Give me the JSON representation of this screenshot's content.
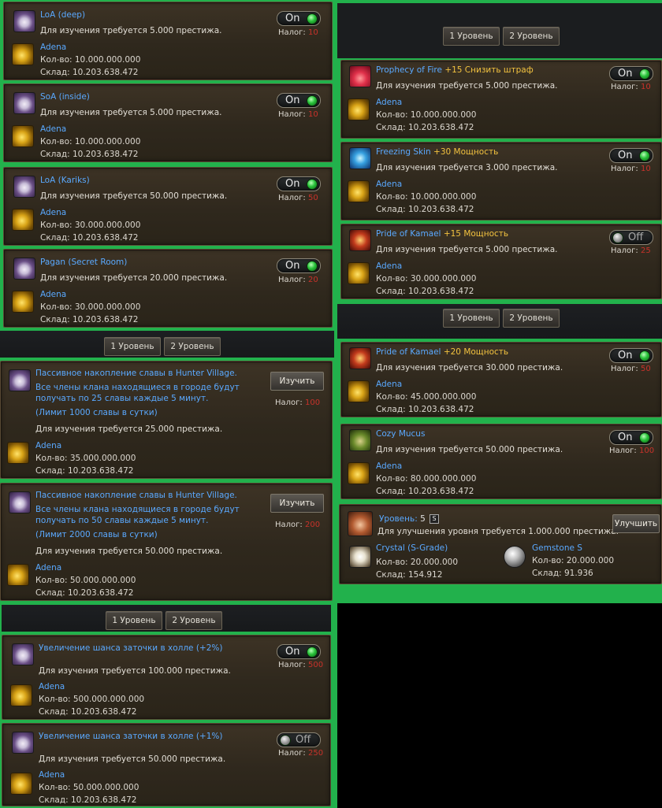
{
  "labels": {
    "requires_prefix": "Для изучения требуется ",
    "requires_suffix": " престижа.",
    "upgrade_requires_prefix": "Для улучшения уровня требуется ",
    "qty_prefix": "Кол-во: ",
    "warehouse_prefix": "Склад: ",
    "tax_label": "Налог: ",
    "adena": "Adena",
    "learn_button": "Изучить",
    "upgrade_button": "Улучшить",
    "level_label": "Уровень:",
    "on": "On",
    "off": "Off",
    "tab1": "1 Уровень",
    "tab2": "2 Уровень"
  },
  "left_skills": [
    {
      "title": "LoA (deep)",
      "prestige": "5.000",
      "qty": "10.000.000.000",
      "warehouse": "10.203.638.472",
      "tax": "10",
      "toggle": "On"
    },
    {
      "title": "SoA (inside)",
      "prestige": "5.000",
      "qty": "10.000.000.000",
      "warehouse": "10.203.638.472",
      "tax": "10",
      "toggle": "On"
    },
    {
      "title": "LoA (Kariks)",
      "prestige": "50.000",
      "qty": "30.000.000.000",
      "warehouse": "10.203.638.472",
      "tax": "50",
      "toggle": "On"
    },
    {
      "title": "Pagan (Secret Room)",
      "prestige": "20.000",
      "qty": "30.000.000.000",
      "warehouse": "10.203.638.472",
      "tax": "20",
      "toggle": "On"
    }
  ],
  "glory_skills": [
    {
      "line1": "Пассивное накопление славы в Hunter Village.",
      "line2": "Все члены клана находящиеся в городе будут",
      "line3": "получать по 25 славы каждые 5 минут.",
      "line4": "(Лимит 1000 славы в сутки)",
      "prestige": "25.000",
      "qty": "35.000.000.000",
      "warehouse": "10.203.638.472",
      "tax": "100"
    },
    {
      "line1": "Пассивное накопление славы в Hunter Village.",
      "line2": "Все члены клана находящиеся в городе будут",
      "line3": "получать по 50 славы каждые 5 минут.",
      "line4": "(Лимит 2000 славы в сутки)",
      "prestige": "50.000",
      "qty": "50.000.000.000",
      "warehouse": "10.203.638.472",
      "tax": "200"
    }
  ],
  "enchant_skills": [
    {
      "title": "Увеличение шанса заточки в холле (+2%)",
      "prestige": "100.000",
      "qty": "500.000.000.000",
      "warehouse": "10.203.638.472",
      "tax": "500",
      "toggle": "On"
    },
    {
      "title": "Увеличение шанса заточки в холле (+1%)",
      "prestige": "50.000",
      "qty": "50.000.000.000",
      "warehouse": "10.203.638.472",
      "tax": "250",
      "toggle": "Off"
    }
  ],
  "right_skills": [
    {
      "title": "Prophecy of Fire",
      "bonus": "+15 Снизить штраф",
      "prestige": "5.000",
      "qty": "10.000.000.000",
      "warehouse": "10.203.638.472",
      "tax": "10",
      "toggle": "On",
      "icon": "fire"
    },
    {
      "title": "Freezing Skin",
      "bonus": "+30 Мощность",
      "prestige": "3.000",
      "qty": "10.000.000.000",
      "warehouse": "10.203.638.472",
      "tax": "10",
      "toggle": "On",
      "icon": "freeze"
    },
    {
      "title": "Pride of Kamael",
      "bonus": "+15 Мощность",
      "prestige": "5.000",
      "qty": "30.000.000.000",
      "warehouse": "10.203.638.472",
      "tax": "25",
      "toggle": "Off",
      "icon": "pride"
    },
    {
      "title": "Pride of Kamael",
      "bonus": "+20 Мощность",
      "prestige": "30.000",
      "qty": "45.000.000.000",
      "warehouse": "10.203.638.472",
      "tax": "50",
      "toggle": "On",
      "icon": "pride"
    },
    {
      "title": "Cozy Mucus",
      "bonus": "",
      "prestige": "50.000",
      "qty": "80.000.000.000",
      "warehouse": "10.203.638.472",
      "tax": "100",
      "toggle": "On",
      "icon": "mucus"
    }
  ],
  "level_panel": {
    "level": "5",
    "grade_badge": "S",
    "prestige": "1.000.000",
    "res1": {
      "name": "Crystal (S-Grade)",
      "qty": "20.000.000",
      "warehouse": "154.912"
    },
    "res2": {
      "name": "Gemstone S",
      "qty": "20.000.000",
      "warehouse": "91.936"
    }
  },
  "colors": {
    "link": "#5aa9ff",
    "bonus": "#f2c23f",
    "tax_value": "#c8322a",
    "background": "#22b14c"
  }
}
